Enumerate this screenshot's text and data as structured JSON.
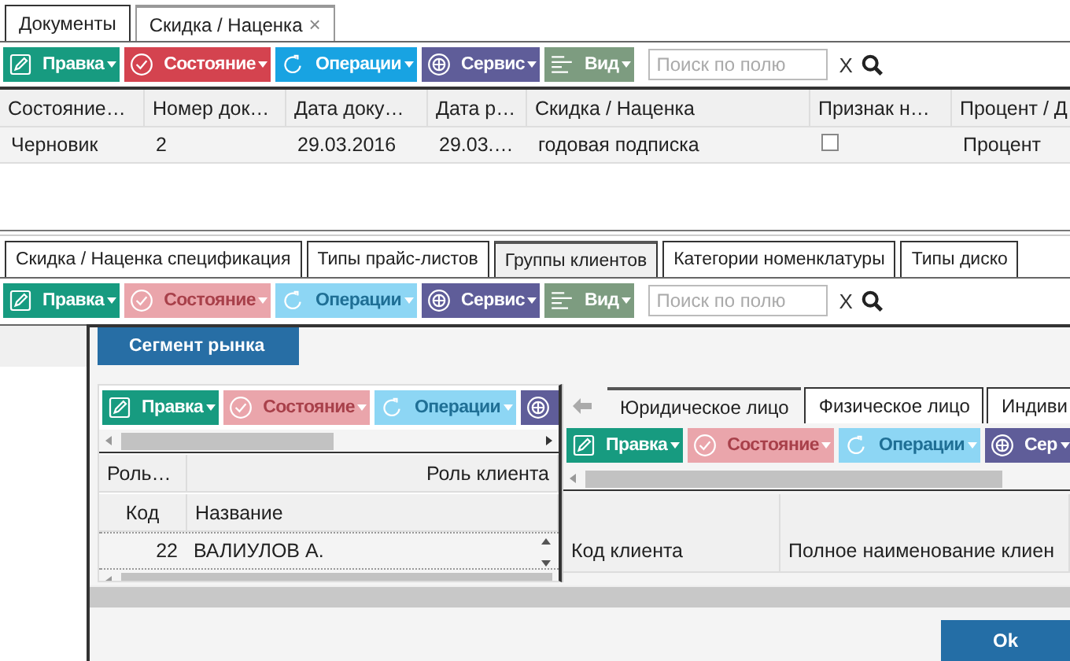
{
  "document_tabs": [
    {
      "label": "Документы",
      "selected": false
    },
    {
      "label": "Скидка / Наценка",
      "selected": true,
      "close": "×"
    }
  ],
  "toolbar": {
    "buttons": [
      {
        "kind": "edit",
        "label": "Правка",
        "disabled": false
      },
      {
        "kind": "state",
        "label": "Состояние",
        "disabled": false
      },
      {
        "kind": "ops",
        "label": "Операции",
        "disabled": false
      },
      {
        "kind": "service",
        "label": "Сервис",
        "disabled": false
      },
      {
        "kind": "view",
        "label": "Вид",
        "disabled": false
      }
    ],
    "search": {
      "placeholder": "Поиск по полю"
    },
    "clear": "X"
  },
  "table": {
    "columns": [
      {
        "label": "Состояние…"
      },
      {
        "label": "Номер док…"
      },
      {
        "label": "Дата доку…"
      },
      {
        "label": "Дата р…"
      },
      {
        "label": "Скидка / Наценка"
      },
      {
        "label": "Признак н…"
      },
      {
        "label": "Процент / Д"
      }
    ],
    "rows": [
      {
        "cells": [
          {
            "kind": "text",
            "text": "Черновик"
          },
          {
            "kind": "text",
            "text": "2"
          },
          {
            "kind": "text",
            "text": "29.03.2016"
          },
          {
            "kind": "text",
            "text": "29.03.…"
          },
          {
            "kind": "text",
            "text": "годовая подписка"
          },
          {
            "kind": "checkbox",
            "checked": false
          },
          {
            "kind": "text",
            "text": "Процент"
          }
        ]
      }
    ]
  },
  "catalog_tabs": [
    {
      "label": "Скидка / Наценка спецификация",
      "selected": false
    },
    {
      "label": "Типы прайс-листов",
      "selected": false
    },
    {
      "label": "Группы клиентов",
      "selected": true
    },
    {
      "label": "Категории номенклатуры",
      "selected": false
    },
    {
      "label": "Типы диско",
      "selected": false
    }
  ],
  "catalog_toolbar": {
    "buttons": [
      {
        "kind": "edit",
        "label": "Правка",
        "disabled": false
      },
      {
        "kind": "state",
        "label": "Состояние",
        "disabled": true
      },
      {
        "kind": "ops",
        "label": "Операции",
        "disabled": true
      },
      {
        "kind": "service",
        "label": "Сервис",
        "disabled": false
      },
      {
        "kind": "view",
        "label": "Вид",
        "disabled": false
      }
    ],
    "search": {
      "placeholder": "Поиск по полю"
    },
    "clear": "X"
  },
  "dialog": {
    "title": "Сегмент рынка",
    "left_panel": {
      "toolbar": {
        "buttons": [
          {
            "kind": "edit",
            "label": "Правка",
            "disabled": false
          },
          {
            "kind": "state",
            "label": "Состояние",
            "disabled": true
          },
          {
            "kind": "ops",
            "label": "Операции",
            "disabled": true
          },
          {
            "kind": "service",
            "disabled": false
          }
        ]
      },
      "header_groups": [
        {
          "label": "Роль…"
        },
        {
          "label": "Роль клиента"
        }
      ],
      "columns": [
        {
          "label": "Код"
        },
        {
          "label": "Название"
        }
      ],
      "rows": [
        {
          "cells": [
            "22",
            "ВАЛИУЛОВ А."
          ]
        }
      ]
    },
    "right_panel": {
      "tabs": [
        {
          "label": "Юридическое лицо",
          "selected": true
        },
        {
          "label": "Физическое лицо",
          "selected": false
        },
        {
          "label": "Индиви",
          "selected": false
        }
      ],
      "toolbar": {
        "buttons": [
          {
            "kind": "edit",
            "label": "Правка",
            "disabled": false
          },
          {
            "kind": "state",
            "label": "Состояние",
            "disabled": true
          },
          {
            "kind": "ops",
            "label": "Операции",
            "disabled": true
          },
          {
            "kind": "service",
            "label": "Сер",
            "disabled": false
          }
        ]
      },
      "columns": [
        {
          "label": "Код клиента"
        },
        {
          "label": "Полное наименование клиен"
        }
      ]
    },
    "ok": "Ok"
  }
}
